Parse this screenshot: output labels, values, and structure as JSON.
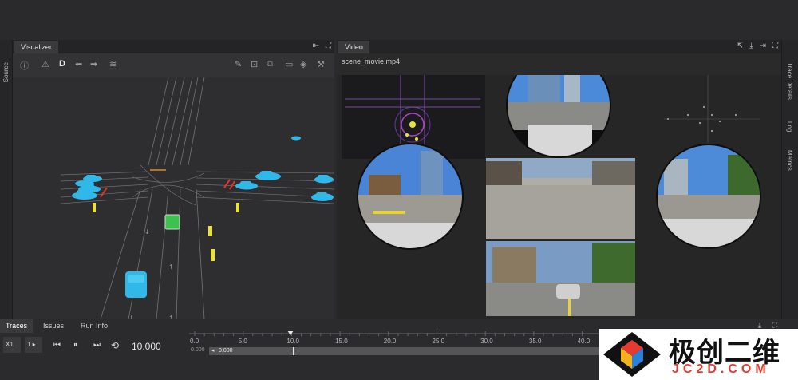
{
  "visualizer": {
    "tab_label": "Visualizer"
  },
  "video": {
    "tab_label": "Video",
    "file_name": "scene_movie.mp4"
  },
  "left_rail": {
    "source_label": "Source"
  },
  "right_rail": {
    "trace_details_label": "Trace Details",
    "log_label": "Log",
    "metrics_label": "Metrics"
  },
  "toolbar": {
    "direction_letter": "D"
  },
  "bottom_tabs": [
    "Traces",
    "Issues",
    "Run Info"
  ],
  "playback": {
    "speed_label": "X1",
    "step_label": "1 ▸",
    "current_time": "10.000",
    "range_start": "0.000",
    "range_value": "0.000",
    "ticks": [
      "0.0",
      "5.0",
      "10.0",
      "15.0",
      "20.0",
      "25.0",
      "30.0",
      "35.0",
      "40.0"
    ]
  },
  "watermark": {
    "chinese": "极创二维",
    "domain": "JC2D.COM"
  },
  "colors": {
    "accent_blue": "#2fb8e8",
    "ego_green": "#3ec24d",
    "marker_yellow": "#e8e23a",
    "brake_red": "#e5332a"
  }
}
